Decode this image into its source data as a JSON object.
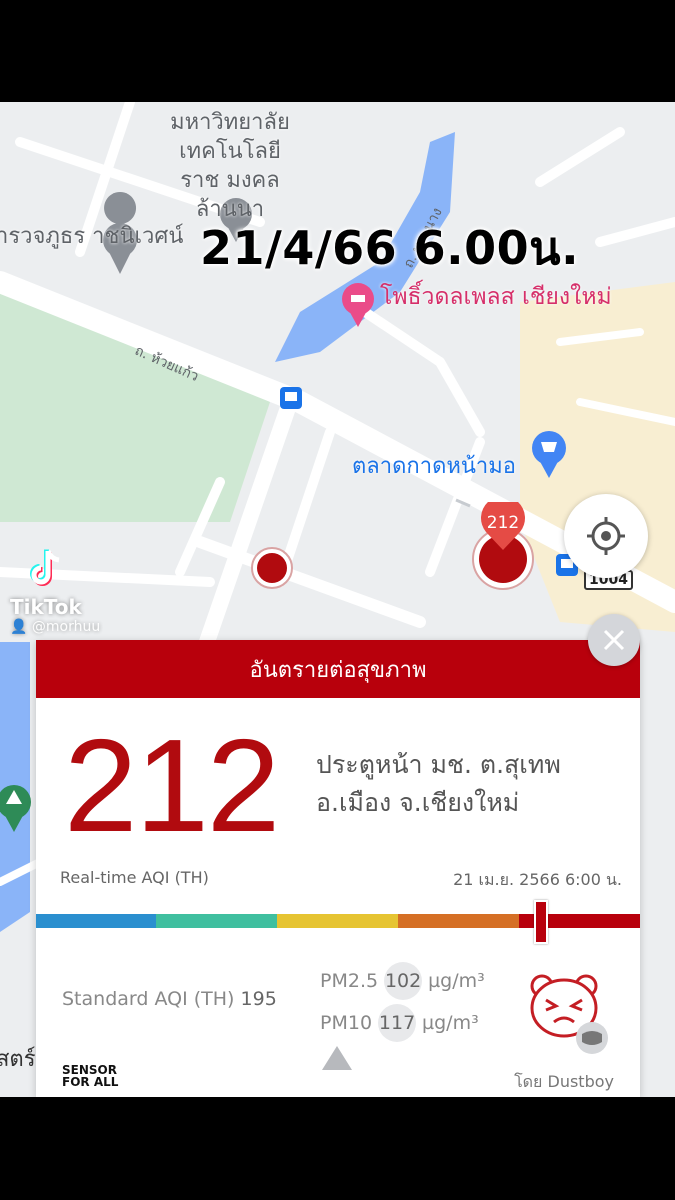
{
  "overlay": {
    "date_time": "21/4/66  6.00น."
  },
  "map": {
    "university": "มหาวิทยาลัย เทคโนโลยีราช มงคลล้านนา",
    "school": "ารวจภูธร าชนิเวศน์",
    "hotel": "โพธิ์วดลเพลส เชียงใหม่",
    "market": "ตลาดกาดหน้ามอ",
    "road_huaykaew": "ถ. ห้วยแก้ว",
    "road_phranang": "ถ. พระนาง",
    "route_number": "1004",
    "side_label": "สตร์ ใหม่",
    "marker_value": "212"
  },
  "watermark": {
    "app": "TikTok",
    "user": "@morhuu"
  },
  "card": {
    "header": "อันตรายต่อสุขภาพ",
    "aqi": "212",
    "station_line1": "ประตูหน้า มช. ต.สุเทพ",
    "station_line2": "อ.เมือง จ.เชียงใหม่",
    "realtime_label": "Real-time AQI (TH)",
    "timestamp": "21 เม.ย. 2566 6:00 น.",
    "standard_label": "Standard AQI (TH)",
    "standard_value": "195",
    "pm25_label": "PM2.5",
    "pm25_value": "102",
    "pm10_label": "PM10",
    "pm10_value": "117",
    "unit": "µg/m³",
    "sensor_logo_line1": "SENSOR",
    "sensor_logo_line2": "FOR ALL",
    "by": "โดย Dustboy"
  },
  "colors": {
    "danger": "#b8000c",
    "scale": [
      "#2a8fcf",
      "#3fbf9f",
      "#e6c432",
      "#d56f25",
      "#b8000c"
    ]
  }
}
